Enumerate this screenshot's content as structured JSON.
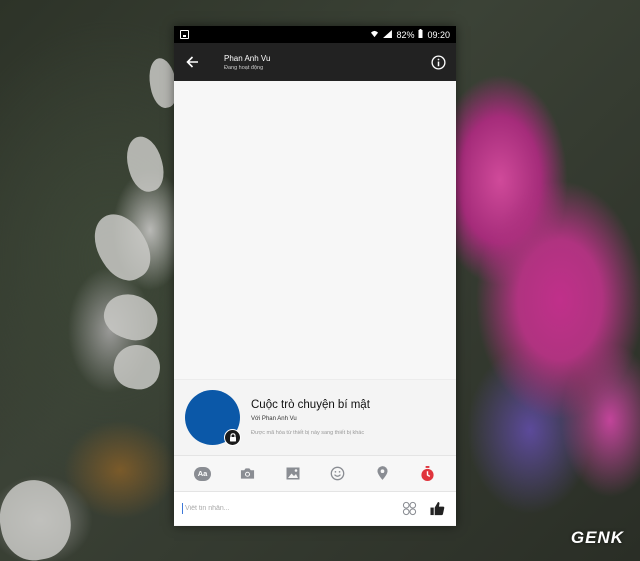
{
  "status_bar": {
    "battery": "82%",
    "time": "09:20"
  },
  "header": {
    "contact_name": "Phan Anh Vu",
    "contact_status": "Đang hoạt động"
  },
  "secret_card": {
    "title": "Cuộc trò chuyện bí mật",
    "with_text": "Với Phan Anh Vu",
    "encryption_note": "Được mã hóa từ thiết bị này sang thiết bị khác"
  },
  "toolbar": {
    "text_button_label": "Aa"
  },
  "composer": {
    "placeholder": "Viết tin nhắn..."
  },
  "watermark": "GENK",
  "colors": {
    "avatar": "#0b58a8",
    "timer_icon": "#e0343c",
    "header_bg": "#222222"
  }
}
